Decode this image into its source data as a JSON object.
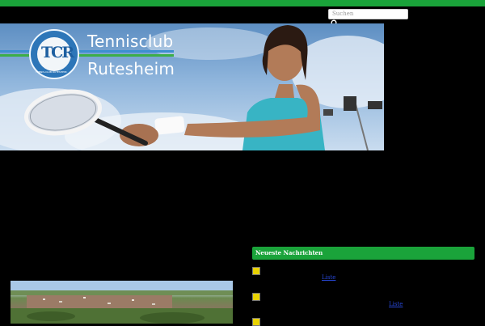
{
  "header": {
    "search": {
      "placeholder": "Suchen"
    },
    "icons": {
      "search": "magnifier-icon"
    }
  },
  "banner": {
    "club_line1": "Tennisclub",
    "club_line2": "Rutesheim",
    "logo_monogram": "TCR",
    "logo_ring_text": "TENNIS-CLUB RUTESHEIM"
  },
  "news": {
    "heading": "Neueste Nachrichten",
    "items": [
      {
        "link": "Liste"
      },
      {
        "link": "Liste"
      }
    ]
  },
  "colors": {
    "accent": "#1aa33a",
    "background": "#000000",
    "link": "#2747d6"
  }
}
